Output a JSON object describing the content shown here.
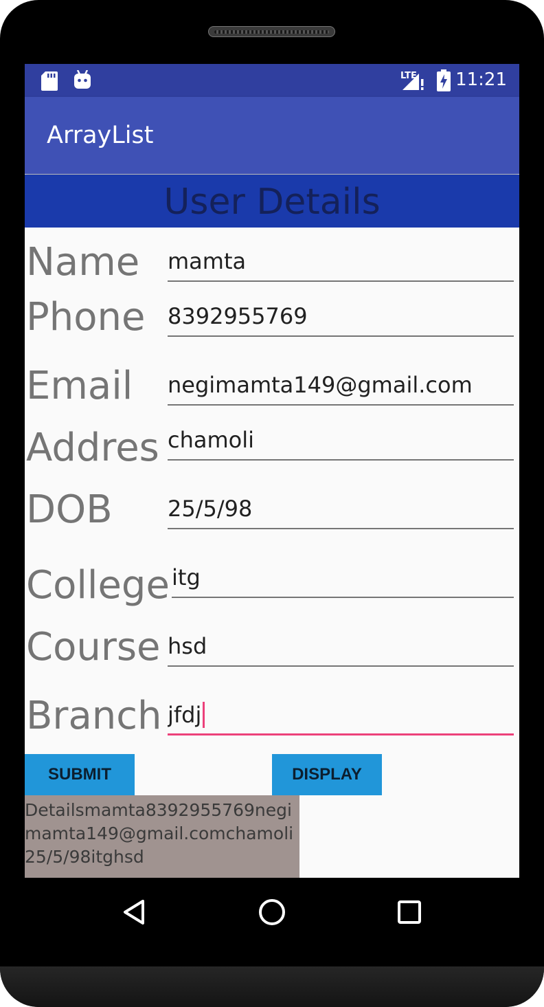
{
  "status_bar": {
    "time": "11:21",
    "network_label": "LTE",
    "icons": [
      "sd-card-icon",
      "android-debug-icon",
      "lte-signal-icon",
      "battery-charging-icon"
    ]
  },
  "app_bar": {
    "title": "ArrayList"
  },
  "header": {
    "title": "User Details"
  },
  "form": {
    "fields": [
      {
        "label": "Name",
        "value": "mamta"
      },
      {
        "label": "Phone",
        "value": "8392955769"
      },
      {
        "label": "Email",
        "value": "negimamta149@gmail.com"
      },
      {
        "label": "Addres",
        "value": "chamoli"
      },
      {
        "label": "DOB",
        "value": "25/5/98"
      },
      {
        "label": "College",
        "value": "itg"
      },
      {
        "label": "Course",
        "value": "hsd"
      },
      {
        "label": "Branch",
        "value": "jfdj"
      }
    ]
  },
  "buttons": {
    "submit": "SUBMIT",
    "display": "DISPLAY"
  },
  "output": {
    "text": "Detailsmamta8392955769negimamta149@gmail.comchamoli25/5/98itghsd"
  },
  "nav_bar": {
    "icons": [
      "back-icon",
      "home-icon",
      "recents-icon"
    ]
  },
  "colors": {
    "status_bar": "#303f9f",
    "app_bar": "#3f51b5",
    "header": "#1a3aab",
    "accent": "#ec407a",
    "button": "#2196d9",
    "output_bg": "#a09390"
  }
}
